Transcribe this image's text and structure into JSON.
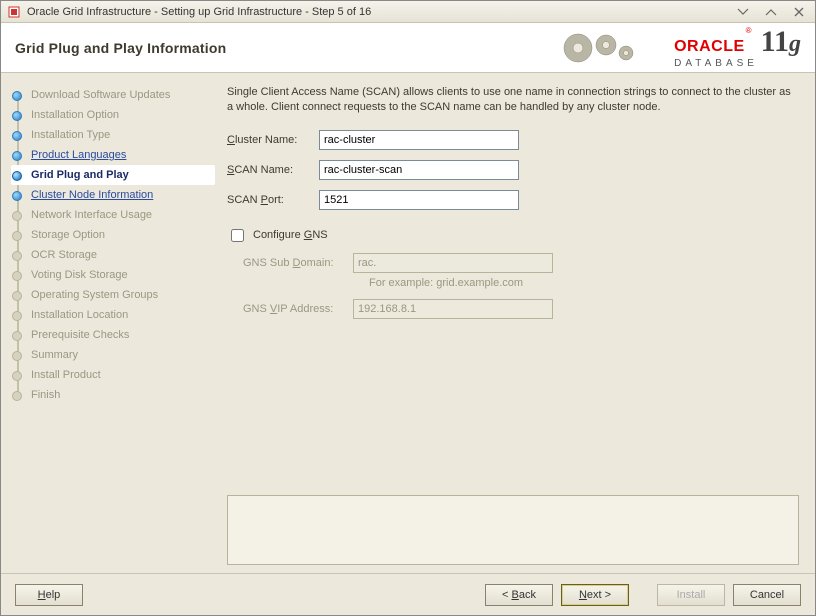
{
  "window": {
    "title": "Oracle Grid Infrastructure - Setting up Grid Infrastructure - Step 5 of 16"
  },
  "header": {
    "title": "Grid Plug and Play Information",
    "brand_oracle": "ORACLE",
    "brand_db": "DATABASE",
    "brand_eleven": "11",
    "brand_g": "g"
  },
  "steps": [
    {
      "label": "Download Software Updates",
      "state": "dim"
    },
    {
      "label": "Installation Option",
      "state": "dim"
    },
    {
      "label": "Installation Type",
      "state": "dim"
    },
    {
      "label": "Product Languages",
      "state": "link"
    },
    {
      "label": "Grid Plug and Play",
      "state": "current"
    },
    {
      "label": "Cluster Node Information",
      "state": "link"
    },
    {
      "label": "Network Interface Usage",
      "state": "dim"
    },
    {
      "label": "Storage Option",
      "state": "dim"
    },
    {
      "label": "OCR Storage",
      "state": "dim"
    },
    {
      "label": "Voting Disk Storage",
      "state": "dim"
    },
    {
      "label": "Operating System Groups",
      "state": "dim"
    },
    {
      "label": "Installation Location",
      "state": "dim"
    },
    {
      "label": "Prerequisite Checks",
      "state": "dim"
    },
    {
      "label": "Summary",
      "state": "dim"
    },
    {
      "label": "Install Product",
      "state": "dim"
    },
    {
      "label": "Finish",
      "state": "dim"
    }
  ],
  "content": {
    "description": "Single Client Access Name (SCAN) allows clients to use one name in connection strings to connect to the cluster as a whole. Client connect requests to the SCAN name can be handled by any cluster node.",
    "cluster_name_label": "Cluster Name:",
    "cluster_name_value": "rac-cluster",
    "scan_name_label": "SCAN Name:",
    "scan_name_value": "rac-cluster-scan",
    "scan_port_label": "SCAN Port:",
    "scan_port_value": "1521",
    "configure_gns_label": "Configure GNS",
    "gns_sub_domain_label": "GNS Sub Domain:",
    "gns_sub_domain_value": "rac.",
    "gns_example": "For example: grid.example.com",
    "gns_vip_label": "GNS VIP Address:",
    "gns_vip_value": "192.168.8.1"
  },
  "footer": {
    "help": "Help",
    "back": "< Back",
    "next": "Next >",
    "install": "Install",
    "cancel": "Cancel"
  }
}
